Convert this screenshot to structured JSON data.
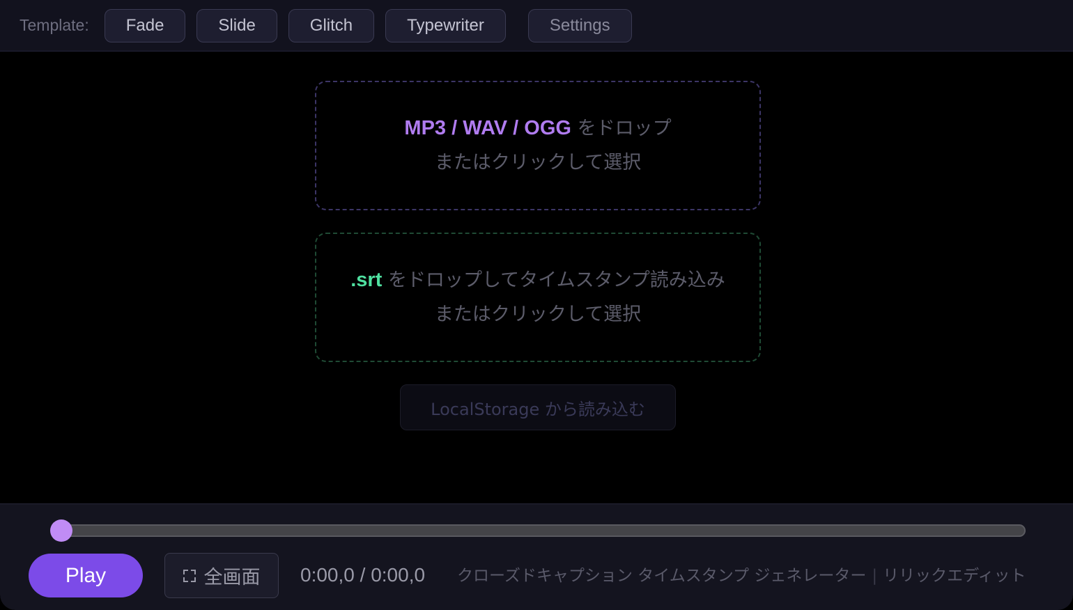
{
  "toolbar": {
    "label": "Template:",
    "templates": [
      "Fade",
      "Slide",
      "Glitch",
      "Typewriter"
    ],
    "settings_label": "Settings"
  },
  "audio_drop": {
    "formats": "MP3 / WAV / OGG",
    "line1_suffix": " をドロップ",
    "line2": "またはクリックして選択"
  },
  "srt_drop": {
    "format": ".srt",
    "line1_suffix": " をドロップしてタイムスタンプ読み込み",
    "line2": "またはクリックして選択"
  },
  "local_storage_button": "LocalStorage から読み込む",
  "player": {
    "progress": 0,
    "play_label": "Play",
    "fullscreen_label": "全画面",
    "time_current": "0:00,0",
    "time_separator": " / ",
    "time_total": "0:00,0",
    "caption_title": "クローズドキャプション タイムスタンプ ジェネレーター",
    "caption_separator": "|",
    "caption_mode": "リリックエディット"
  },
  "colors": {
    "accent": "#7c4be8",
    "audio_highlight": "#b07cf0",
    "srt_highlight": "#4fe0a0"
  },
  "icons": {
    "fullscreen": "fullscreen-icon"
  }
}
